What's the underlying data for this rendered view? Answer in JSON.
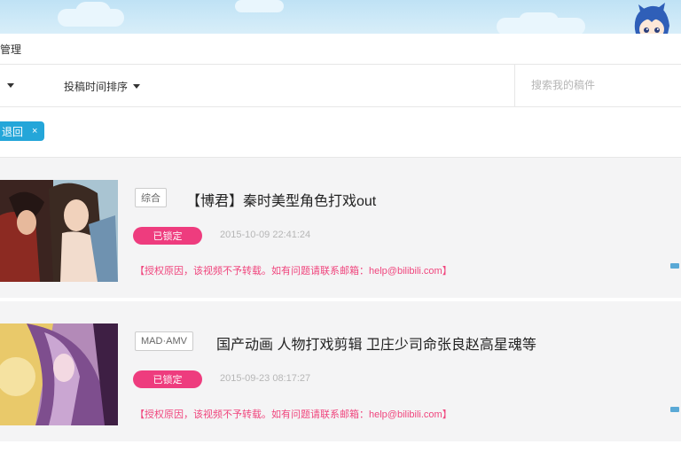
{
  "page": {
    "title": "管理"
  },
  "toolbar": {
    "sort_label": "投稿时间排序",
    "search_placeholder": "搜索我的稿件"
  },
  "filter": {
    "tag_label": "退回",
    "remove_glyph": "×"
  },
  "items": [
    {
      "zone": "综合",
      "title": "【博君】秦时美型角色打戏out",
      "status": "已锁定",
      "time": "2015-10-09 22:41:24",
      "reason": "【授权原因，该视频不予转载。如有问题请联系邮箱：help@bilibili.com】"
    },
    {
      "zone": "MAD·AMV",
      "title": "国产动画 人物打戏剪辑 卫庄少司命张良赵高星魂等",
      "status": "已锁定",
      "time": "2015-09-23 08:17:27",
      "reason": "【授权原因，该视频不予转载。如有问题请联系邮箱：help@bilibili.com】"
    }
  ],
  "colors": {
    "accent_blue": "#24a6d9",
    "status_pink": "#ee3c7e",
    "reason_pink": "#f0457d"
  }
}
